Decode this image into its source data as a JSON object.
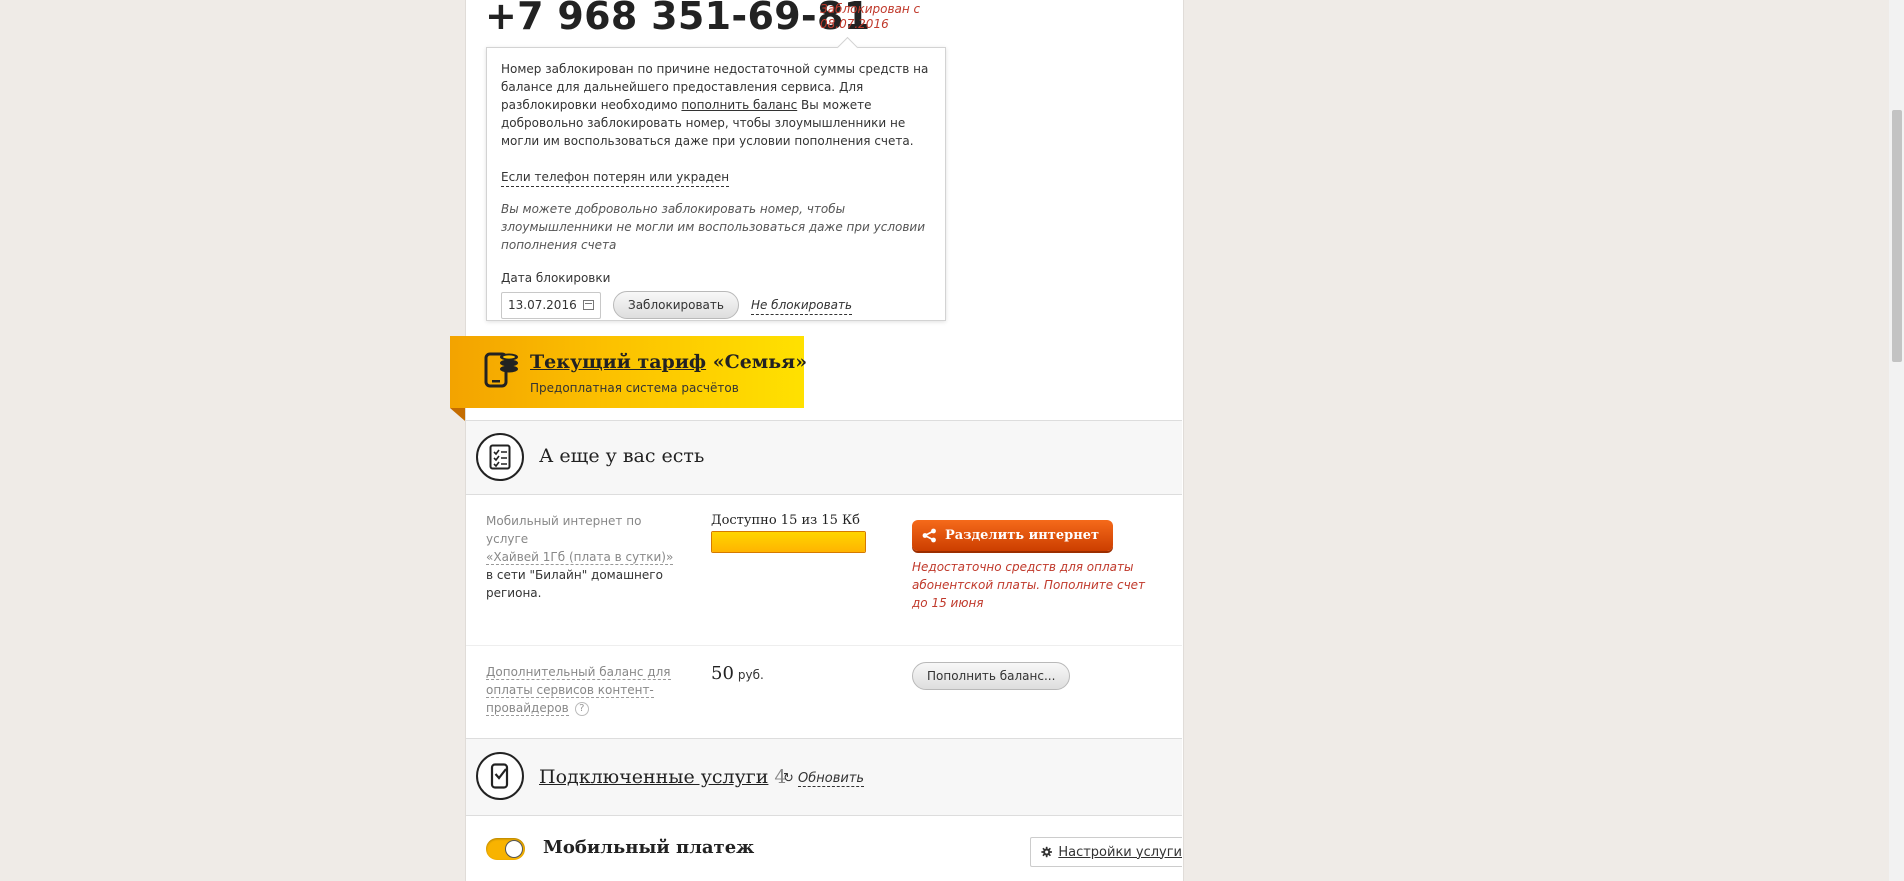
{
  "header": {
    "phone": "+7 968 351-69-81",
    "blocked_since": "Заблокирован с 08.07.2016"
  },
  "block_popup": {
    "text_before": "Номер заблокирован по причине недостаточной суммы средств на балансе для дальнейшего предоставления сервиса. Для разблокировки необходимо ",
    "topup_link": "пополнить баланс",
    "text_after": " Вы можете добровольно заблокировать номер, чтобы злоумышленники не могли им воспользоваться даже при условии пополнения счета.",
    "lost_link": "Если телефон потерян или украден",
    "note": "Вы можете добровольно заблокировать номер, чтобы злоумышленники не могли им воспользоваться даже при условии пополнения счета",
    "date_label": "Дата блокировки",
    "date_value": "13.07.2016",
    "block_button": "Заблокировать",
    "no_block_link": "Не блокировать"
  },
  "tariff": {
    "title_prefix": "Текущий тариф",
    "title_name": " «Семья»",
    "subtitle": "Предоплатная система расчётов"
  },
  "extras": {
    "title": "А еще у вас есть",
    "internet": {
      "label_line1": "Мобильный интернет по услуге",
      "label_link": "«Хайвей 1Гб (плата в сутки)»",
      "label_line3": " в сети \"Билайн\" домашнего региона.",
      "available": "Доступно 15 из 15 Кб",
      "fraction": 1.0,
      "share_button": "Разделить интернет",
      "warning": "Недостаточно средств для оплаты абонентской платы. Пополните счет до 15 июня"
    },
    "extra_balance": {
      "label": "Дополнительный баланс для оплаты сервисов контент-провайдеров",
      "help": "?",
      "amount": "50",
      "unit": "руб.",
      "topup_button": "Пополнить баланс..."
    }
  },
  "services": {
    "title": "Подключенные услуги",
    "count": "4",
    "refresh": "Обновить",
    "first": {
      "name": "Мобильный платеж",
      "enabled": true,
      "settings_button": "Настройки услуги"
    }
  },
  "colors": {
    "accent_red": "#c0392b",
    "tariff_yellow": "#fcc100",
    "share_orange": "#e85a12"
  }
}
